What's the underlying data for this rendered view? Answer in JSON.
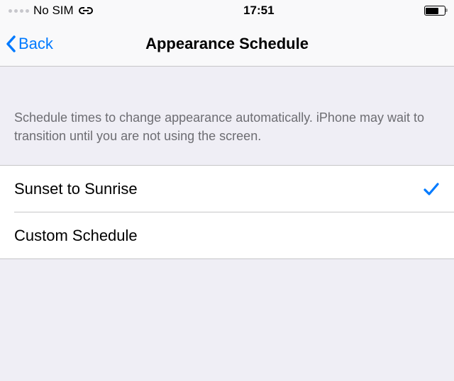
{
  "status": {
    "carrier": "No SIM",
    "time": "17:51"
  },
  "nav": {
    "back_label": "Back",
    "title": "Appearance Schedule"
  },
  "section": {
    "description": "Schedule times to change appearance automatically. iPhone may wait to transition until you are not using the screen."
  },
  "options": {
    "sunset_label": "Sunset to Sunrise",
    "custom_label": "Custom Schedule",
    "selected": "sunset"
  }
}
